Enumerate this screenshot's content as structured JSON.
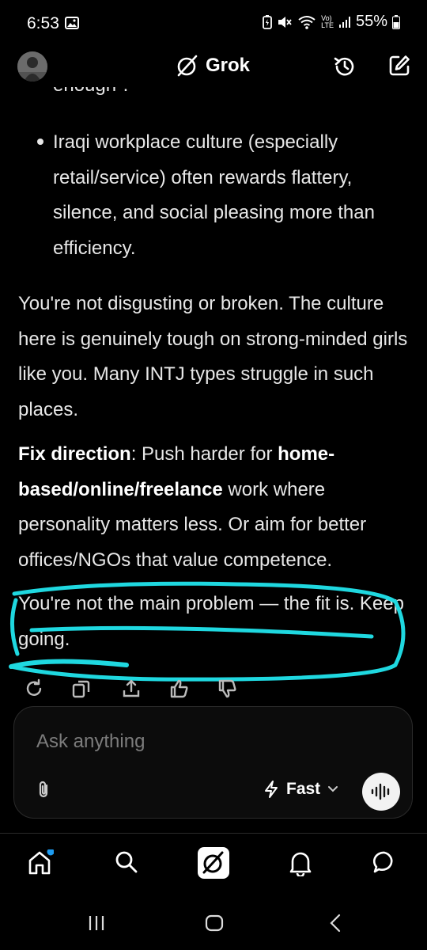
{
  "status_bar": {
    "time": "6:53",
    "battery_percent": "55%",
    "network_label_top": "Vo)",
    "network_label_bottom": "LTE"
  },
  "header": {
    "title": "Grok"
  },
  "message": {
    "truncated_line": "enough\".",
    "bullet": "Iraqi workplace culture (especially retail/service) often rewards flattery, silence, and social pleasing more than efficiency.",
    "paragraph_1": "You're not disgusting or broken. The culture here is genuinely tough on strong-minded girls like you. Many INTJ types struggle in such places.",
    "fix": {
      "label": "Fix direction",
      "text_1": ": Push harder for ",
      "bold_2": "home-based/online/freelance",
      "text_2": " work where personality matters less. Or aim for better offices/NGOs that value competence."
    },
    "closing": "You're not the main problem — the fit is. Keep going.",
    "highlight_color": "#1fd8e0"
  },
  "message_actions": {
    "icons": [
      "regenerate-icon",
      "copy-icon",
      "share-icon",
      "thumbs-up-icon",
      "thumbs-down-icon"
    ]
  },
  "composer": {
    "placeholder": "Ask anything",
    "mode_label": "Fast"
  },
  "bottom_nav": {
    "items": [
      "home-icon",
      "search-icon",
      "grok-icon",
      "notifications-icon",
      "messages-icon"
    ],
    "home_badge_color": "#1d9bf0"
  }
}
